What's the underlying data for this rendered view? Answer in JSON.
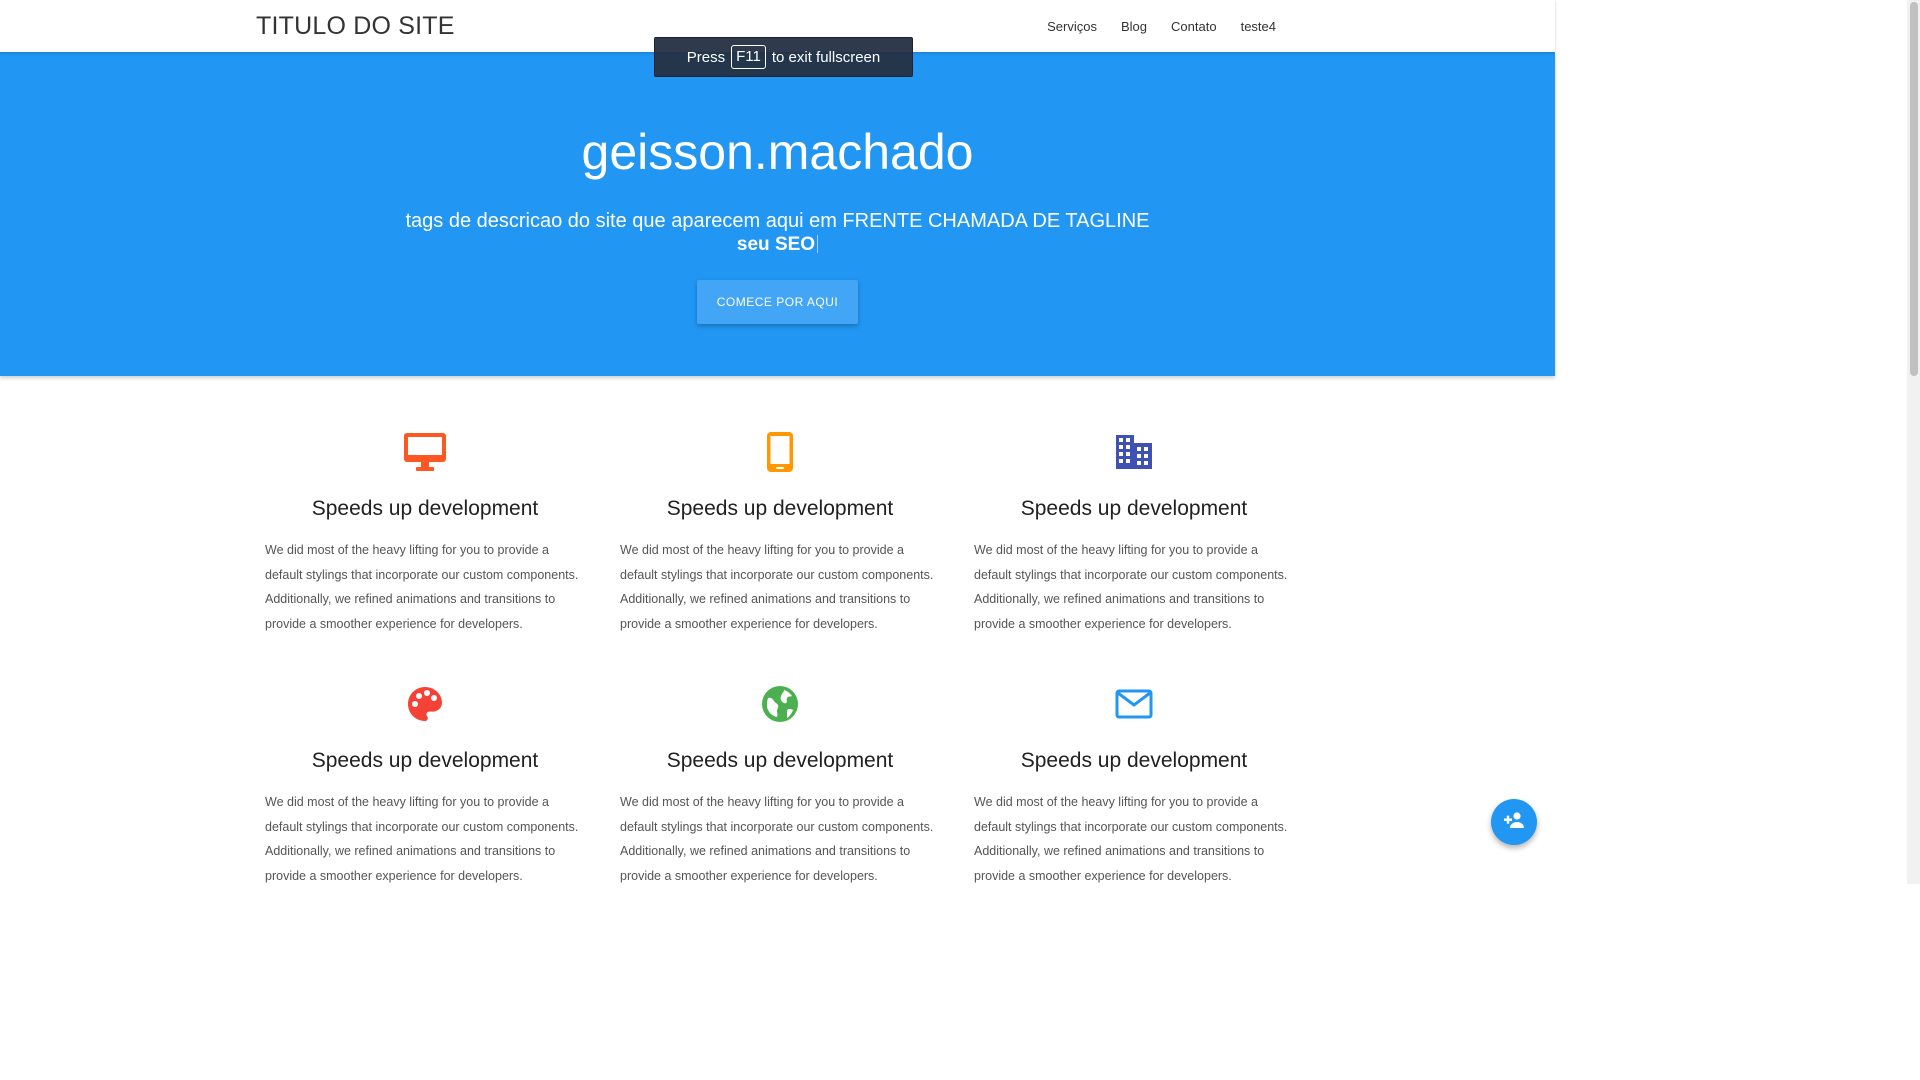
{
  "nav": {
    "brand": "TITULO DO SITE",
    "links": [
      "Serviços",
      "Blog",
      "Contato",
      "teste4"
    ]
  },
  "fullscreen_notice": {
    "before": "Press",
    "key": "F11",
    "after": "to exit fullscreen"
  },
  "hero": {
    "title": "geisson.machado",
    "tagline": "tags de descricao do site que aparecem aqui em FRENTE CHAMADA DE TAGLINE",
    "typed_text": "seu SEO",
    "cta_label": "COMECE POR AQUI",
    "background_color": "#2196f3"
  },
  "features": [
    {
      "icon": "desktop-icon",
      "color": "#ff5722",
      "title": "Speeds up development",
      "text": "We did most of the heavy lifting for you to provide a default stylings that incorporate our custom components. Additionally, we refined animations and transitions to provide a smoother experience for developers."
    },
    {
      "icon": "tablet-icon",
      "color": "#ff9800",
      "title": "Speeds up development",
      "text": "We did most of the heavy lifting for you to provide a default stylings that incorporate our custom components. Additionally, we refined animations and transitions to provide a smoother experience for developers."
    },
    {
      "icon": "building-icon",
      "color": "#3f51b5",
      "title": "Speeds up development",
      "text": "We did most of the heavy lifting for you to provide a default stylings that incorporate our custom components. Additionally, we refined animations and transitions to provide a smoother experience for developers."
    },
    {
      "icon": "palette-icon",
      "color": "#f44336",
      "title": "Speeds up development",
      "text": "We did most of the heavy lifting for you to provide a default stylings that incorporate our custom components. Additionally, we refined animations and transitions to provide a smoother experience for developers."
    },
    {
      "icon": "globe-icon",
      "color": "#4caf50",
      "title": "Speeds up development",
      "text": "We did most of the heavy lifting for you to provide a default stylings that incorporate our custom components. Additionally, we refined animations and transitions to provide a smoother experience for developers."
    },
    {
      "icon": "mail-icon",
      "color": "#2196f3",
      "title": "Speeds up development",
      "text": "We did most of the heavy lifting for you to provide a default stylings that incorporate our custom components. Additionally, we refined animations and transitions to provide a smoother experience for developers."
    }
  ],
  "fab": {
    "icon": "add-person-icon",
    "color": "#2196f3"
  }
}
